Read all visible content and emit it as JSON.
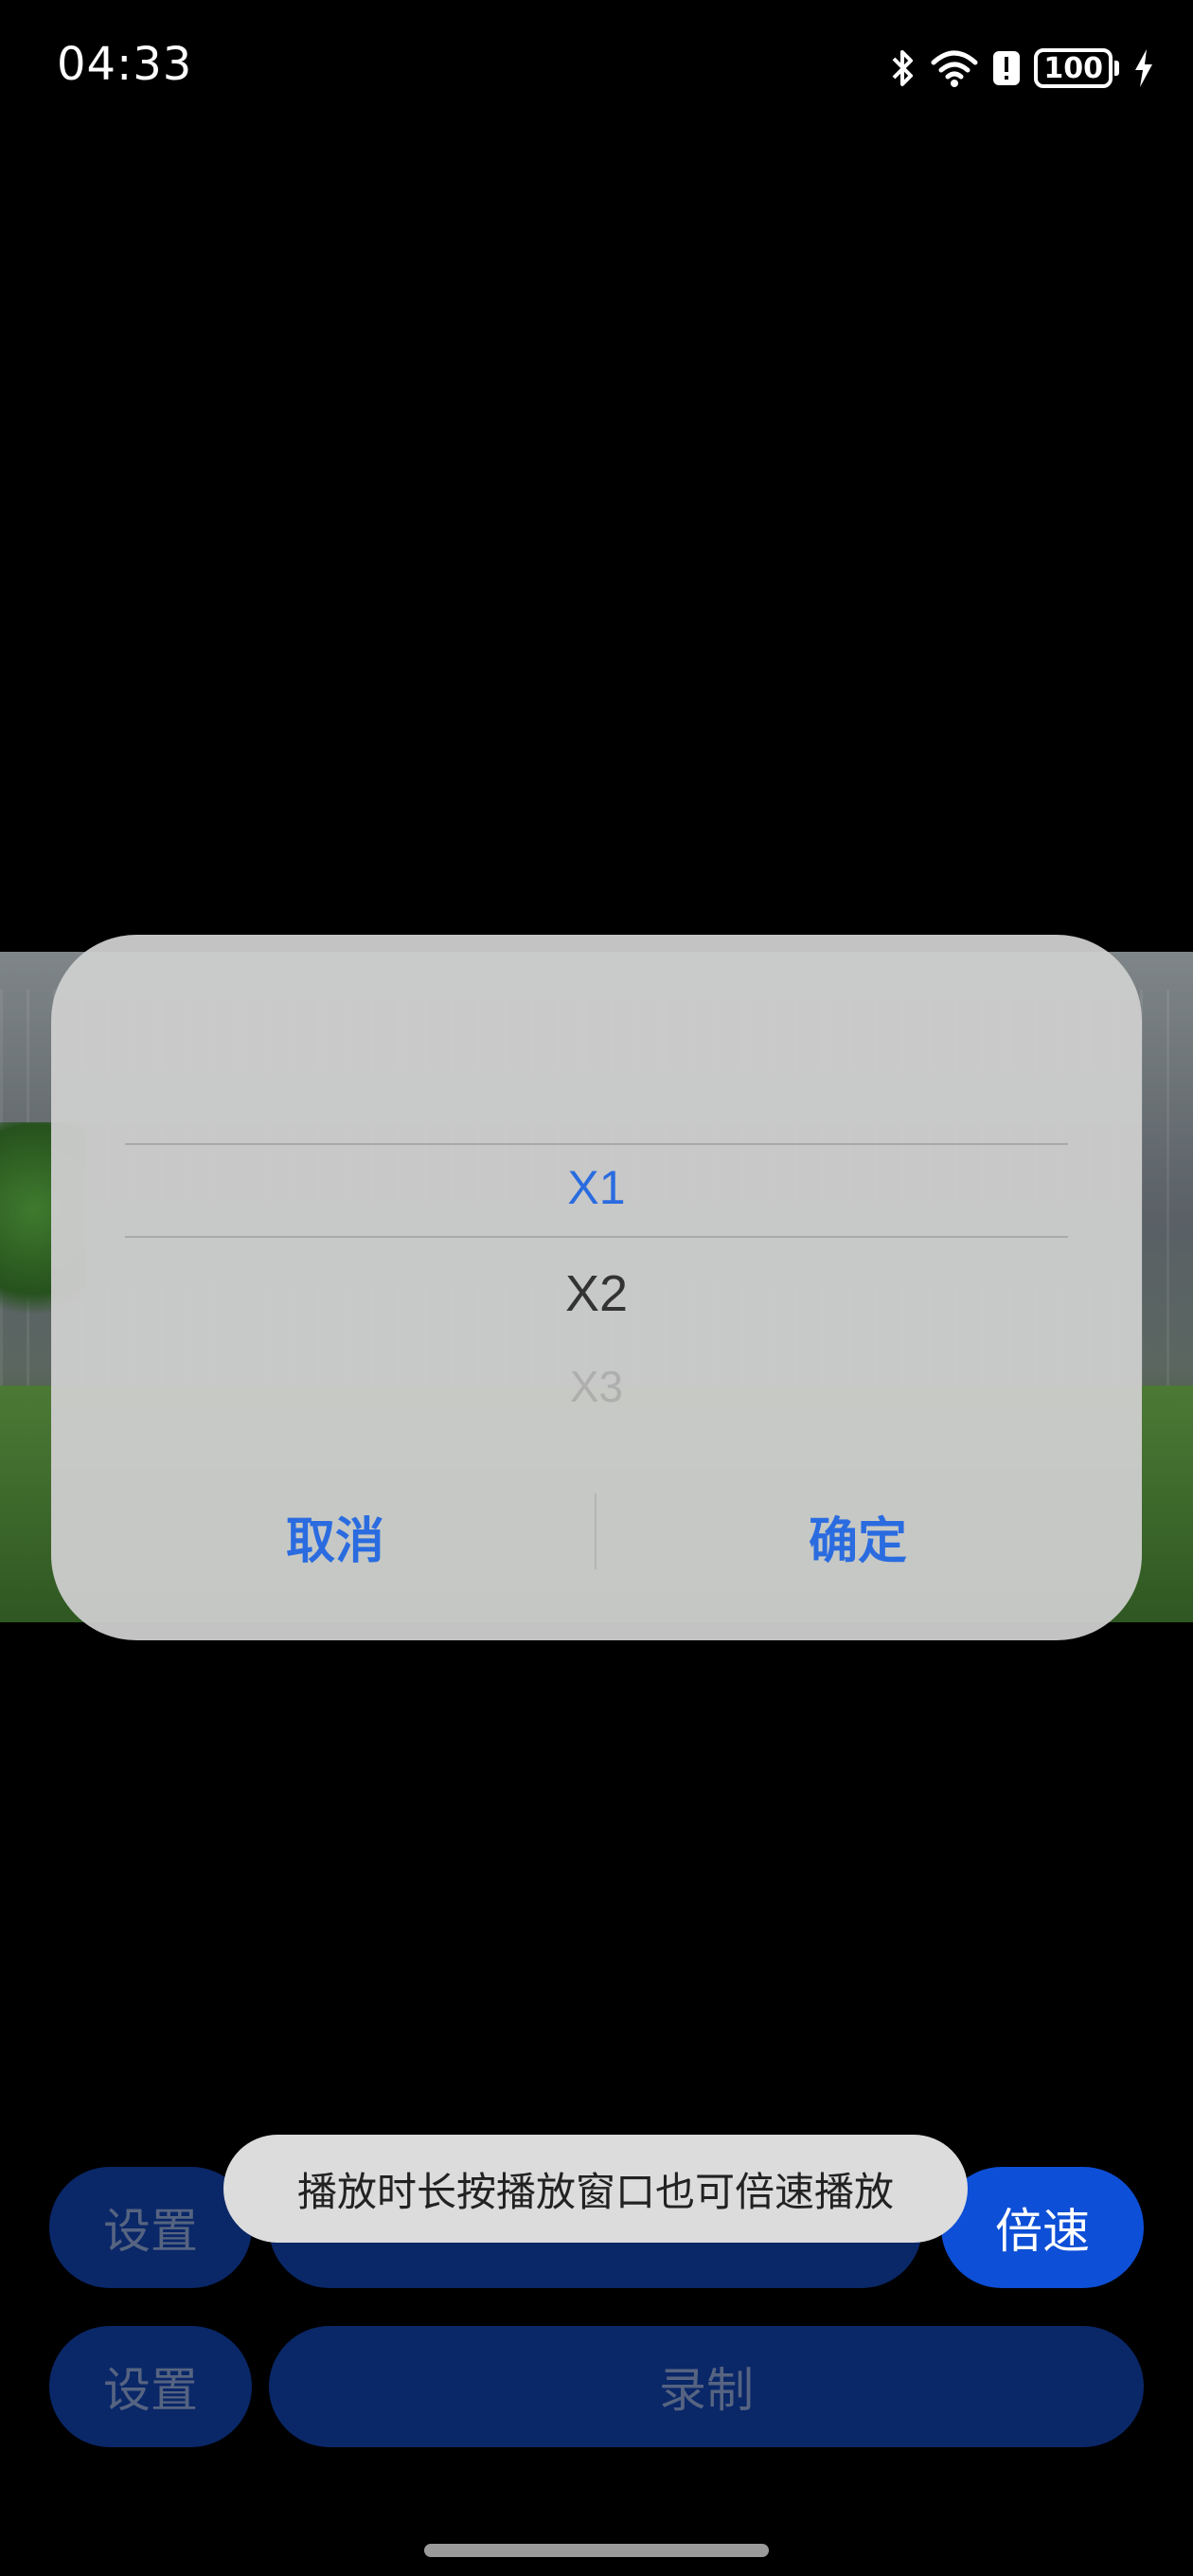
{
  "status_bar": {
    "time": "04:33",
    "battery_level": "100",
    "icons": [
      "bluetooth-icon",
      "wifi-icon",
      "alert-icon",
      "battery-icon",
      "charging-icon"
    ]
  },
  "speed_picker": {
    "selected_option": "X1",
    "options": [
      "X1",
      "X2",
      "X3"
    ],
    "cancel_label": "取消",
    "confirm_label": "确定",
    "accent_color": "#2a6ce0"
  },
  "toast": {
    "message": "播放时长按播放窗口也可倍速播放"
  },
  "controls": {
    "row1": {
      "settings_label": "设置",
      "speed_label": "倍速"
    },
    "row2": {
      "settings_label": "设置",
      "record_label": "录制"
    },
    "colors": {
      "dim_button": "#0a2768",
      "active_button": "#0d4fd6"
    }
  }
}
